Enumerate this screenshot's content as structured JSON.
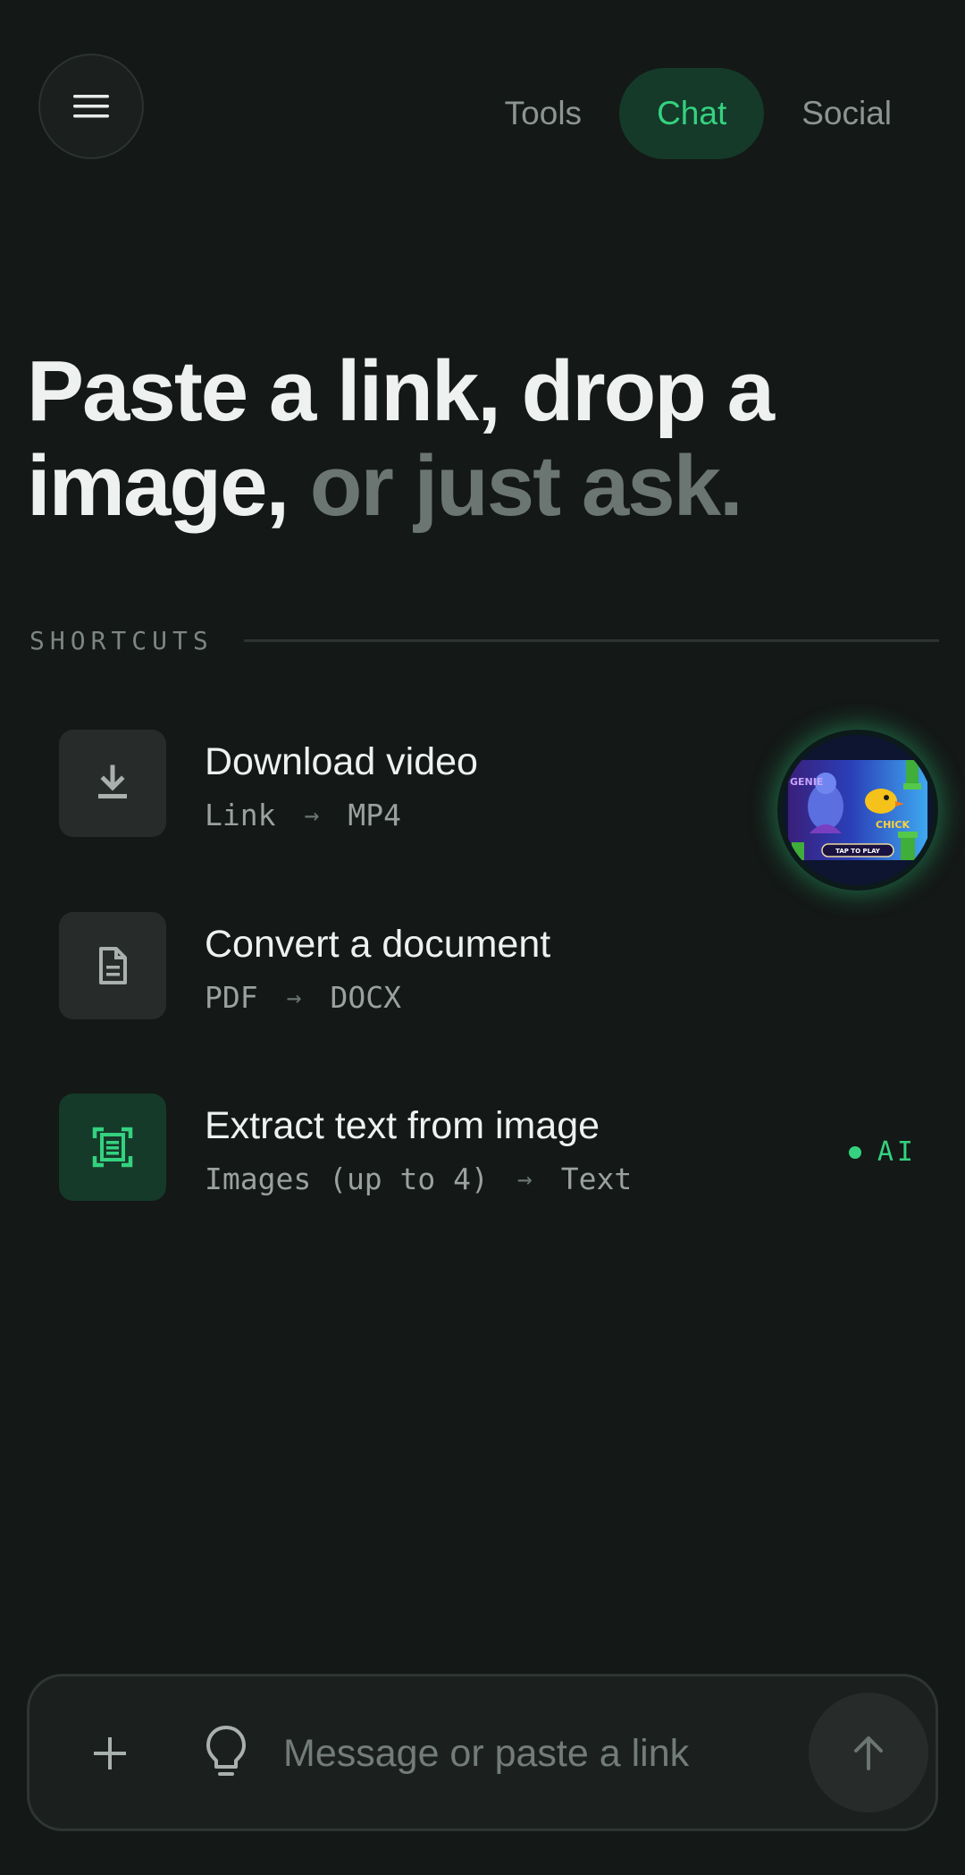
{
  "header": {
    "menu_icon": "hamburger-menu-icon",
    "tabs": [
      {
        "label": "Tools",
        "active": false
      },
      {
        "label": "Chat",
        "active": true
      },
      {
        "label": "Social",
        "active": false
      }
    ]
  },
  "hero": {
    "line1": "Paste a link, drop a",
    "line2_strong": "image,",
    "line2_muted": "or just ask."
  },
  "shortcuts": {
    "label": "SHORTCUTS",
    "items": [
      {
        "title": "Download video",
        "from": "Link",
        "arrow": "→",
        "to": "MP4",
        "icon": "download-icon"
      },
      {
        "title": "Convert a document",
        "from": "PDF",
        "arrow": "→",
        "to": "DOCX",
        "icon": "document-icon"
      },
      {
        "title": "Extract text from image",
        "from": "Images (up to 4)",
        "arrow": "→",
        "to": "Text",
        "icon": "scan-text-icon",
        "badge": "AI"
      }
    ]
  },
  "game_bubble": {
    "icon": "game-thumbnail",
    "text_left": "GENIE",
    "text_right": "CHICK",
    "cta": "TAP TO PLAY"
  },
  "composer": {
    "placeholder": "Message or paste a link",
    "value": "",
    "plus_icon": "plus-icon",
    "idea_icon": "lightbulb-icon",
    "send_icon": "arrow-up-icon"
  },
  "colors": {
    "background": "#141817",
    "accent": "#34d27f",
    "accent_bg": "#153a2a"
  }
}
